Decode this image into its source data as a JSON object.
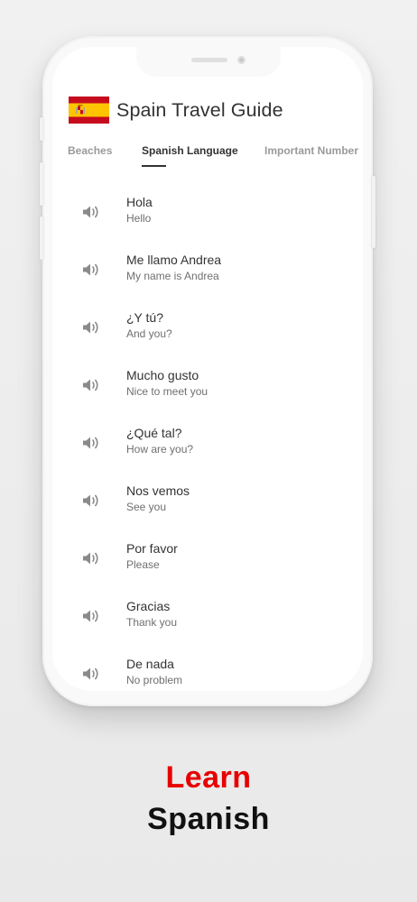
{
  "app": {
    "title": "Spain Travel Guide",
    "flag_icon": "spain-flag-icon"
  },
  "tabs": [
    {
      "label": "Beaches",
      "active": false
    },
    {
      "label": "Spanish Language",
      "active": true
    },
    {
      "label": "Important Number",
      "active": false
    }
  ],
  "phrases": [
    {
      "spanish": "Hola",
      "english": "Hello",
      "icon": "volume-icon"
    },
    {
      "spanish": "Me llamo Andrea",
      "english": "My name is Andrea",
      "icon": "volume-icon"
    },
    {
      "spanish": "¿Y tú?",
      "english": "And you?",
      "icon": "volume-icon"
    },
    {
      "spanish": "Mucho gusto",
      "english": "Nice to meet you",
      "icon": "volume-icon"
    },
    {
      "spanish": "¿Qué tal?",
      "english": "How are you?",
      "icon": "volume-icon"
    },
    {
      "spanish": "Nos vemos",
      "english": "See you",
      "icon": "volume-icon"
    },
    {
      "spanish": "Por favor",
      "english": "Please",
      "icon": "volume-icon"
    },
    {
      "spanish": "Gracias",
      "english": "Thank you",
      "icon": "volume-icon"
    },
    {
      "spanish": "De nada",
      "english": "No problem",
      "icon": "volume-icon"
    }
  ],
  "caption": {
    "line1": "Learn",
    "line2": "Spanish"
  },
  "colors": {
    "accent_red": "#e60000",
    "flag_red": "#c60b1e",
    "flag_yellow": "#ffc400",
    "text_dark": "#333333",
    "text_muted": "#6f6f6f",
    "tab_inactive": "#9a9a9a"
  }
}
